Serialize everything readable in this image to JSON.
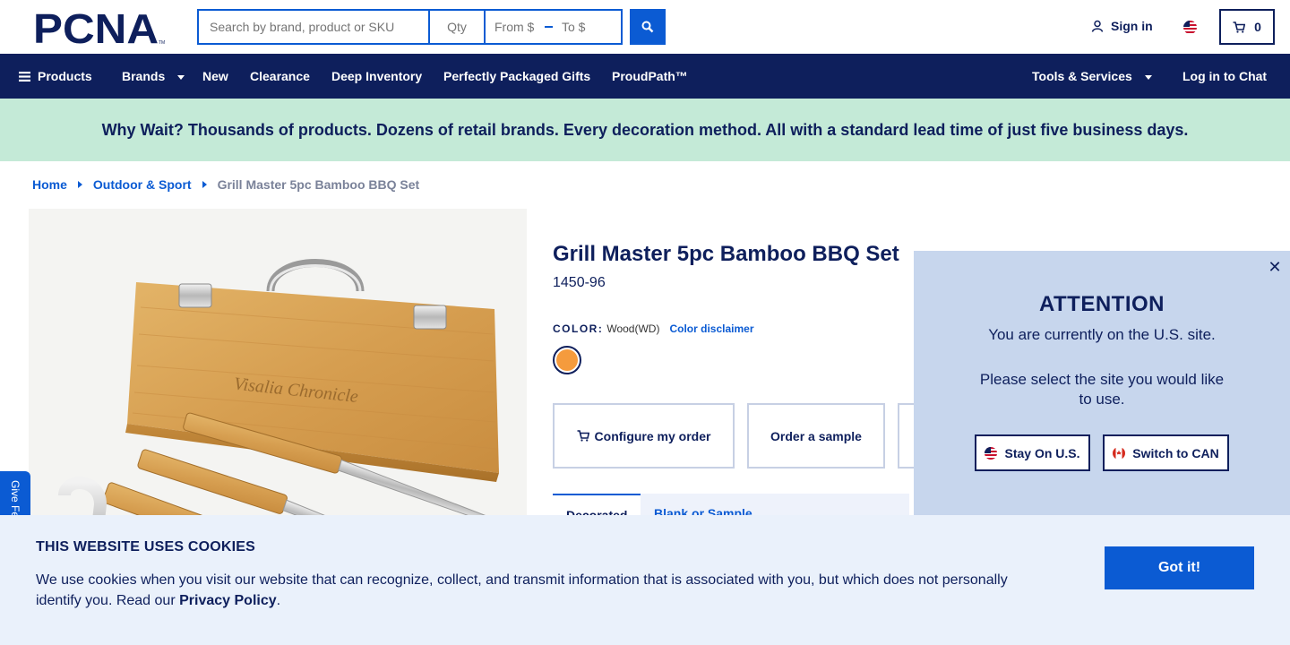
{
  "header": {
    "logo_text": "PCNA",
    "search": {
      "placeholder": "Search by brand, product or SKU"
    },
    "qty": {
      "placeholder": "Qty"
    },
    "price": {
      "from_placeholder": "From $",
      "to_placeholder": "To $"
    },
    "sign_in": "Sign in",
    "cart_count": "0"
  },
  "nav": {
    "products": "Products",
    "brands": "Brands",
    "new": "New",
    "clearance": "Clearance",
    "deep_inventory": "Deep Inventory",
    "gifts": "Perfectly Packaged Gifts",
    "proudpath": "ProudPath™",
    "tools": "Tools & Services",
    "chat": "Log in to Chat"
  },
  "promo": "Why Wait? Thousands of products. Dozens of retail brands. Every decoration method. All with a standard lead time of just five business days.",
  "breadcrumb": {
    "home": "Home",
    "category": "Outdoor & Sport",
    "current": "Grill Master 5pc Bamboo BBQ Set"
  },
  "product": {
    "title": "Grill Master 5pc Bamboo BBQ Set",
    "sku": "1450-96",
    "color_label": "COLOR:",
    "color_value": "Wood(WD)",
    "color_disclaimer": "Color disclaimer",
    "imprint_text": "Visalia Chronicle",
    "configure_btn": "Configure my order",
    "sample_btn": "Order a sample",
    "tab_active": "Decorated",
    "tab_inactive": "Blank or Sample"
  },
  "attention": {
    "title": "ATTENTION",
    "message": "You are currently on the U.S. site.",
    "message2": "Please select the site you would like to use.",
    "stay_btn": "Stay On U.S.",
    "switch_btn": "Switch to CAN"
  },
  "feedback": "Give Feedback",
  "cookie": {
    "title": "THIS WEBSITE USES COOKIES",
    "text": "We use cookies when you visit our website that can recognize, collect, and transmit information that is associated with you, but which does not personally identify you. Read our",
    "link": "Privacy Policy",
    "after": ".",
    "button": "Got it!"
  },
  "colors": {
    "navy": "#0e1f5c",
    "blue": "#0b5bd3",
    "promo_green": "#c4ead7",
    "swatch": "#f59b3d"
  }
}
